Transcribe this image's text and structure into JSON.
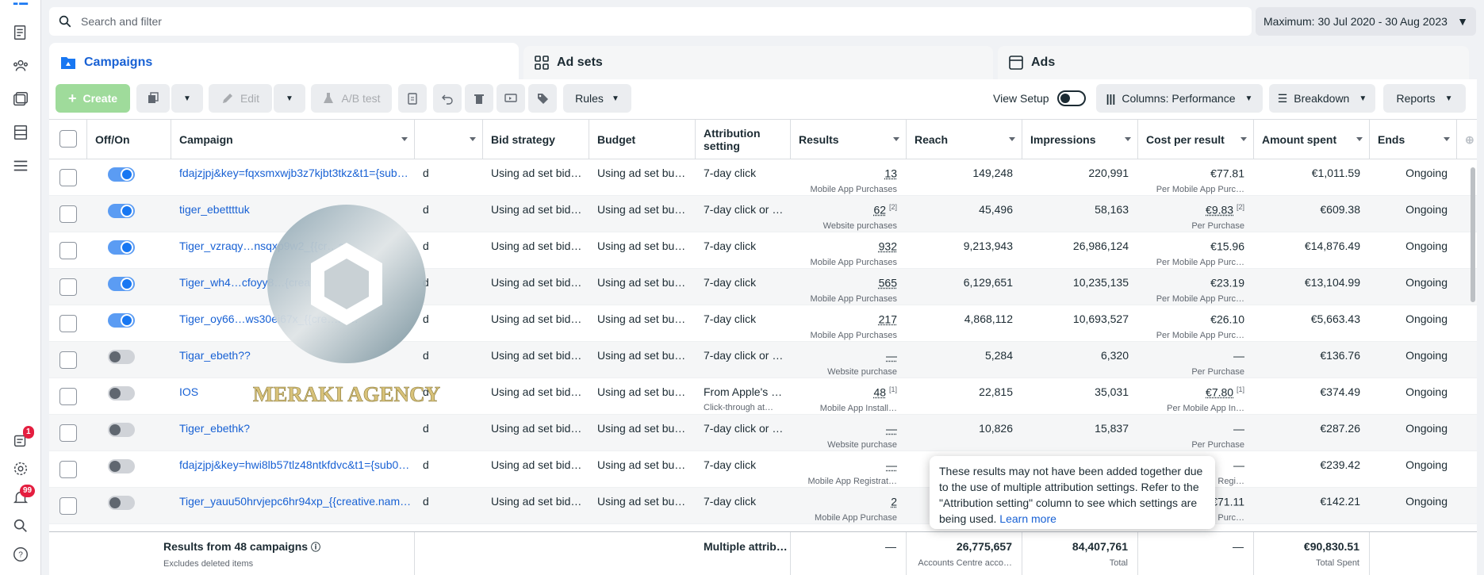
{
  "search": {
    "placeholder": "Search and filter"
  },
  "date_range": {
    "label": "Maximum: 30 Jul 2020 - 30 Aug 2023"
  },
  "tabs": [
    {
      "label": "Campaigns"
    },
    {
      "label": "Ad sets"
    },
    {
      "label": "Ads"
    }
  ],
  "toolbar": {
    "create": "Create",
    "edit": "Edit",
    "ab_test": "A/B test",
    "rules": "Rules",
    "view_setup": "View Setup",
    "columns": "Columns: Performance",
    "breakdown": "Breakdown",
    "reports": "Reports"
  },
  "nav": {
    "notifications_badge": "1",
    "alerts_badge": "99"
  },
  "columns": {
    "off_on": "Off/On",
    "campaign": "Campaign",
    "bid_strategy": "Bid strategy",
    "budget": "Budget",
    "attribution": "Attribution setting",
    "results": "Results",
    "reach": "Reach",
    "impressions": "Impressions",
    "cost_per_result": "Cost per result",
    "amount_spent": "Amount spent",
    "ends": "Ends"
  },
  "rows": [
    {
      "on": true,
      "name": "fdajzjpj&key=fqxsmxwjb3z7kjbt3tkz&t1={sub…",
      "partial": "d",
      "bid": "Using ad set bid…",
      "budget": "Using ad set bu…",
      "attr": "7-day click",
      "attr_sub": "",
      "result": "13",
      "result_sup": "",
      "result_sub": "Mobile App Purchases",
      "reach": "149,248",
      "impr": "220,991",
      "cpr": "€77.81",
      "cpr_sup": "",
      "cpr_sub": "Per Mobile App Purc…",
      "spent": "€1,011.59",
      "ends": "Ongoing"
    },
    {
      "on": true,
      "name": "tiger_ebettttuk",
      "partial": "d",
      "bid": "Using ad set bid…",
      "budget": "Using ad set bu…",
      "attr": "7-day click or …",
      "attr_sub": "",
      "result": "62",
      "result_sup": "[2]",
      "result_sub": "Website purchases",
      "reach": "45,496",
      "impr": "58,163",
      "cpr": "€9.83",
      "cpr_sup": "[2]",
      "cpr_sub": "Per Purchase",
      "spent": "€609.38",
      "ends": "Ongoing"
    },
    {
      "on": true,
      "name": "Tiger_vzraqy…nsqxp9w2_{{cr…a…",
      "partial": "d",
      "bid": "Using ad set bid…",
      "budget": "Using ad set bu…",
      "attr": "7-day click",
      "attr_sub": "",
      "result": "932",
      "result_sup": "",
      "result_sub": "Mobile App Purchases",
      "reach": "9,213,943",
      "impr": "26,986,124",
      "cpr": "€15.96",
      "cpr_sup": "",
      "cpr_sub": "Per Mobile App Purc…",
      "spent": "€14,876.49",
      "ends": "Ongoing"
    },
    {
      "on": true,
      "name": "Tiger_wh4…cfoyy8…{creative.name…",
      "partial": "d",
      "bid": "Using ad set bid…",
      "budget": "Using ad set bu…",
      "attr": "7-day click",
      "attr_sub": "",
      "result": "565",
      "result_sup": "",
      "result_sub": "Mobile App Purchases",
      "reach": "6,129,651",
      "impr": "10,235,135",
      "cpr": "€23.19",
      "cpr_sup": "",
      "cpr_sub": "Per Mobile App Purc…",
      "spent": "€13,104.99",
      "ends": "Ongoing"
    },
    {
      "on": true,
      "name": "Tiger_oy66…ws30ei67x_{{cre…m…",
      "partial": "d",
      "bid": "Using ad set bid…",
      "budget": "Using ad set bu…",
      "attr": "7-day click",
      "attr_sub": "",
      "result": "217",
      "result_sup": "",
      "result_sub": "Mobile App Purchases",
      "reach": "4,868,112",
      "impr": "10,693,527",
      "cpr": "€26.10",
      "cpr_sup": "",
      "cpr_sub": "Per Mobile App Purc…",
      "spent": "€5,663.43",
      "ends": "Ongoing"
    },
    {
      "on": false,
      "name": "Tigar_ebeth??",
      "partial": "d",
      "bid": "Using ad set bid…",
      "budget": "Using ad set bu…",
      "attr": "7-day click or …",
      "attr_sub": "",
      "result": "—",
      "result_sup": "",
      "result_sub": "Website purchase",
      "reach": "5,284",
      "impr": "6,320",
      "cpr": "—",
      "cpr_sup": "",
      "cpr_sub": "Per Purchase",
      "spent": "€136.76",
      "ends": "Ongoing"
    },
    {
      "on": false,
      "name": "IOS",
      "partial": "d",
      "bid": "Using ad set bid…",
      "budget": "Using ad set bu…",
      "attr": "From Apple's …",
      "attr_sub": "Click-through at…",
      "result": "48",
      "result_sup": "[1]",
      "result_sub": "Mobile App Install…",
      "reach": "22,815",
      "impr": "35,031",
      "cpr": "€7.80",
      "cpr_sup": "[1]",
      "cpr_sub": "Per Mobile App In…",
      "spent": "€374.49",
      "ends": "Ongoing"
    },
    {
      "on": false,
      "name": "Tiger_ebethk?",
      "partial": "d",
      "bid": "Using ad set bid…",
      "budget": "Using ad set bu…",
      "attr": "7-day click or …",
      "attr_sub": "",
      "result": "—",
      "result_sup": "",
      "result_sub": "Website purchase",
      "reach": "10,826",
      "impr": "15,837",
      "cpr": "—",
      "cpr_sup": "",
      "cpr_sub": "Per Purchase",
      "spent": "€287.26",
      "ends": "Ongoing"
    },
    {
      "on": false,
      "name": "fdajzjpj&key=hwi8lb57tlz48ntkfdvc&t1={sub0…",
      "partial": "d",
      "bid": "Using ad set bid…",
      "budget": "Using ad set bu…",
      "attr": "7-day click",
      "attr_sub": "",
      "result": "—",
      "result_sup": "",
      "result_sub": "Mobile App Registrat…",
      "reach": "",
      "impr": "",
      "cpr": "—",
      "cpr_sup": "",
      "cpr_sub": "…bile App Regi…",
      "spent": "€239.42",
      "ends": "Ongoing"
    },
    {
      "on": false,
      "name": "Tiger_yauu50hrvjepc6hr94xp_{{creative.nam…",
      "partial": "d",
      "bid": "Using ad set bid…",
      "budget": "Using ad set bu…",
      "attr": "7-day click",
      "attr_sub": "",
      "result": "2",
      "result_sup": "",
      "result_sub": "Mobile App Purchase",
      "reach": "",
      "impr": "",
      "cpr": "€71.11",
      "cpr_sup": "",
      "cpr_sub": "Per Mobile App Purc…",
      "spent": "€142.21",
      "ends": "Ongoing"
    }
  ],
  "footer": {
    "title": "Results from 48 campaigns",
    "sub": "Excludes deleted items",
    "attr": "Multiple attrib…",
    "results": "—",
    "reach": "26,775,657",
    "reach_sub": "Accounts Centre acco…",
    "impr": "84,407,761",
    "impr_sub": "Total",
    "cpr": "—",
    "spent": "€90,830.51",
    "spent_sub": "Total Spent"
  },
  "tooltip": {
    "text": "These results may not have been added together due to the use of multiple attribution settings. Refer to the \"Attribution setting\" column to see which settings are being used.",
    "link": "Learn more"
  },
  "watermark": {
    "text": "MERAKI AGENCY"
  },
  "colors": {
    "accent": "#1861d4",
    "toggle_on": "#1877f2",
    "create": "#9fdb9b",
    "topbar": "#e4533a"
  }
}
